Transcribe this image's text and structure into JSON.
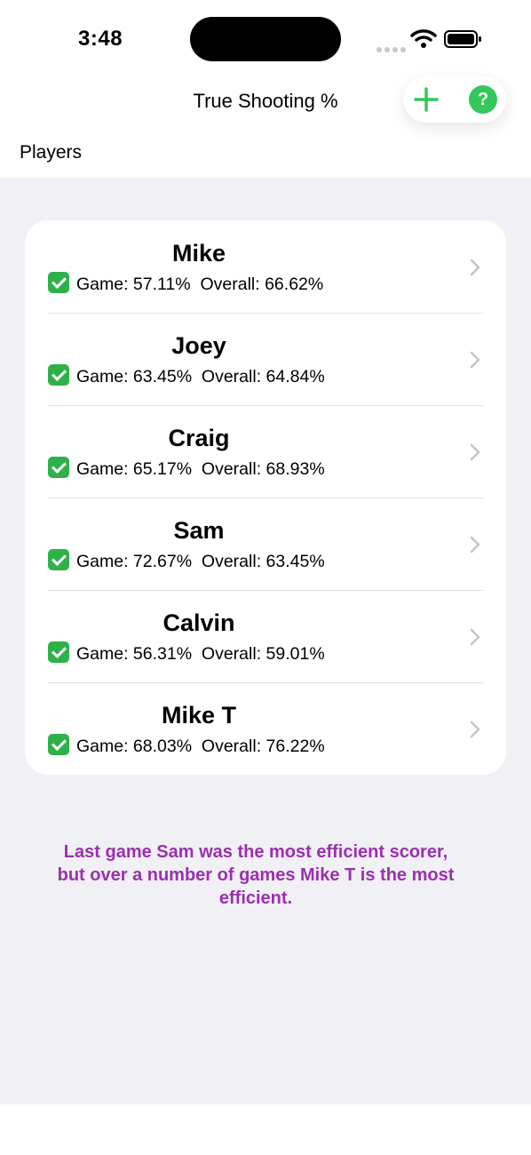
{
  "status_bar": {
    "time": "3:48"
  },
  "nav": {
    "title": "True Shooting %",
    "section_label": "Players",
    "help_label": "?"
  },
  "players": [
    {
      "name": "Mike",
      "game": "Game: 57.11%",
      "overall": "Overall: 66.62%"
    },
    {
      "name": "Joey",
      "game": "Game: 63.45%",
      "overall": "Overall: 64.84%"
    },
    {
      "name": "Craig",
      "game": "Game: 65.17%",
      "overall": "Overall: 68.93%"
    },
    {
      "name": "Sam",
      "game": "Game: 72.67%",
      "overall": "Overall: 63.45%"
    },
    {
      "name": "Calvin",
      "game": "Game: 56.31%",
      "overall": "Overall: 59.01%"
    },
    {
      "name": "Mike T",
      "game": "Game: 68.03%",
      "overall": "Overall: 76.22%"
    }
  ],
  "summary": "Last game Sam was the most efficient scorer, but over a number of games Mike T is the most efficient.",
  "colors": {
    "accent": "#34c759",
    "summary_text": "#9b2fb0",
    "background": "#f1f0f5"
  },
  "icons": {
    "add": "plus-icon",
    "help": "question-icon",
    "check": "checkmark-icon",
    "chevron": "chevron-right-icon"
  }
}
